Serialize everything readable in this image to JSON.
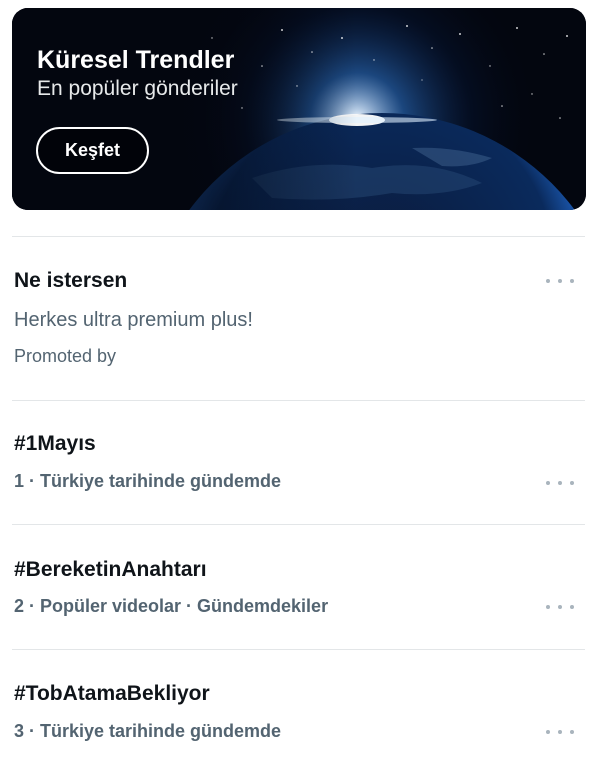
{
  "banner": {
    "title": "Küresel Trendler",
    "subtitle": "En popüler gönderiler",
    "button_label": "Keşfet"
  },
  "promoted": {
    "title": "Ne istersen",
    "text": "Herkes ultra premium plus!",
    "promoted_label": "Promoted by"
  },
  "trends": [
    {
      "hashtag": "#1Mayıs",
      "meta": "1 · Türkiye tarihinde gündemde"
    },
    {
      "hashtag": "#BereketinAnahtarı",
      "meta": "2 · Popüler videolar · Gündemdekiler"
    },
    {
      "hashtag": "#TobAtamaBekliyor",
      "meta": "3 · Türkiye tarihinde gündemde"
    }
  ],
  "icons": {
    "more": "more-horizontal-icon"
  }
}
